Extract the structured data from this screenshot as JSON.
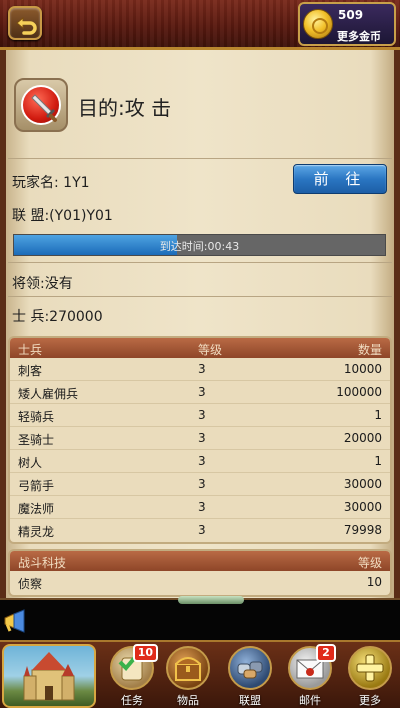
{
  "header": {
    "gold_amount": "509",
    "more_gold_label": "更多金币"
  },
  "mission": {
    "title": "目的:攻 击",
    "player_name": "玩家名: 1Y1",
    "alliance": "联 盟:(Y01)Y01",
    "go_button": "前 往",
    "arrival": "到达时间:00:43",
    "progress_fraction": 0.44,
    "general": "将领:没有",
    "soldiers": "士 兵:270000"
  },
  "troops_table": {
    "headers": [
      "士兵",
      "等级",
      "数量"
    ],
    "rows": [
      [
        "刺客",
        "3",
        "10000"
      ],
      [
        "矮人雇佣兵",
        "3",
        "100000"
      ],
      [
        "轻骑兵",
        "3",
        "1"
      ],
      [
        "圣骑士",
        "3",
        "20000"
      ],
      [
        "树人",
        "3",
        "1"
      ],
      [
        "弓箭手",
        "3",
        "30000"
      ],
      [
        "魔法师",
        "3",
        "30000"
      ],
      [
        "精灵龙",
        "3",
        "79998"
      ]
    ]
  },
  "tech_table": {
    "headers": [
      "战斗科技",
      "等级"
    ],
    "rows": [
      [
        "侦察",
        "10"
      ]
    ]
  },
  "bottom_nav": {
    "items": [
      {
        "label": "任务",
        "badge": "10",
        "icon": "quest-scroll-icon"
      },
      {
        "label": "物品",
        "badge": "",
        "icon": "treasure-chest-icon"
      },
      {
        "label": "联盟",
        "badge": "",
        "icon": "alliance-handshake-icon"
      },
      {
        "label": "邮件",
        "badge": "2",
        "icon": "mail-envelope-icon"
      },
      {
        "label": "更多",
        "badge": "",
        "icon": "plus-icon"
      }
    ]
  },
  "colors": {
    "accent_blue": "#2b76c2",
    "table_header": "#8e4628",
    "badge_red": "#e02a1a"
  }
}
